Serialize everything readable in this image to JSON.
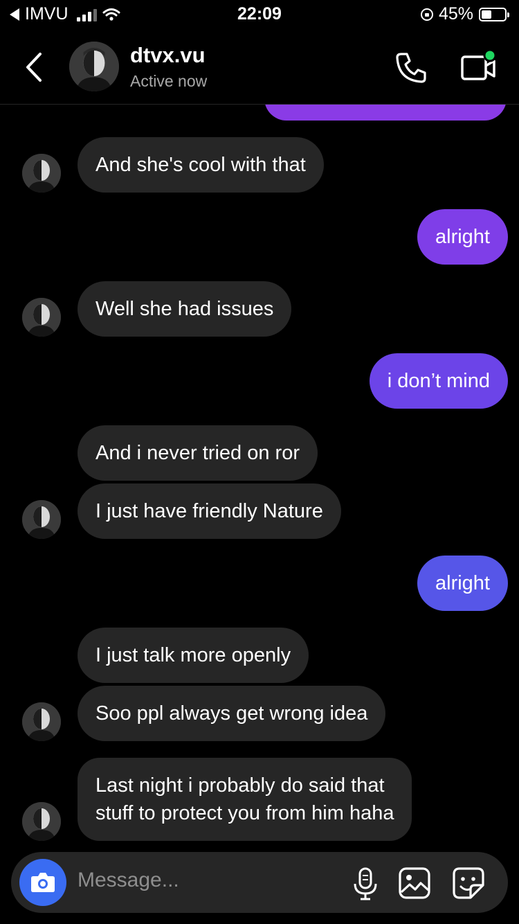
{
  "status_bar": {
    "carrier": "IMVU",
    "time": "22:09",
    "battery_text": "45%",
    "battery_level": 0.45
  },
  "header": {
    "username": "dtvx.vu",
    "status": "Active now",
    "back_icon": "chevron-left-icon",
    "call_icon": "phone-icon",
    "video_icon": "video-camera-icon"
  },
  "messages": [
    {
      "side": "in",
      "text": "And she's cool with that"
    },
    {
      "side": "out",
      "text": "alright"
    },
    {
      "side": "in",
      "text": "Well she had issues"
    },
    {
      "side": "out",
      "text": "i don’t mind"
    },
    {
      "side": "in",
      "text": "And i never tried on ror"
    },
    {
      "side": "in",
      "text": "I just have friendly Nature"
    },
    {
      "side": "out",
      "text": "alright"
    },
    {
      "side": "in",
      "text": "I just talk more openly"
    },
    {
      "side": "in",
      "text": "Soo ppl always get wrong idea"
    },
    {
      "side": "in",
      "text": "Last night i probably do said that\nstuff to protect you from him haha"
    }
  ],
  "composer": {
    "placeholder": "Message...",
    "camera_icon": "camera-icon",
    "mic_icon": "microphone-icon",
    "gallery_icon": "image-icon",
    "sticker_icon": "sticker-icon"
  },
  "colors": {
    "background": "#000000",
    "incoming_bubble": "#262626",
    "outgoing_top": "#8a3be6",
    "outgoing_bottom": "#4f5ae6",
    "camera_button": "#3a6cf2",
    "active_dot": "#1ed760"
  }
}
